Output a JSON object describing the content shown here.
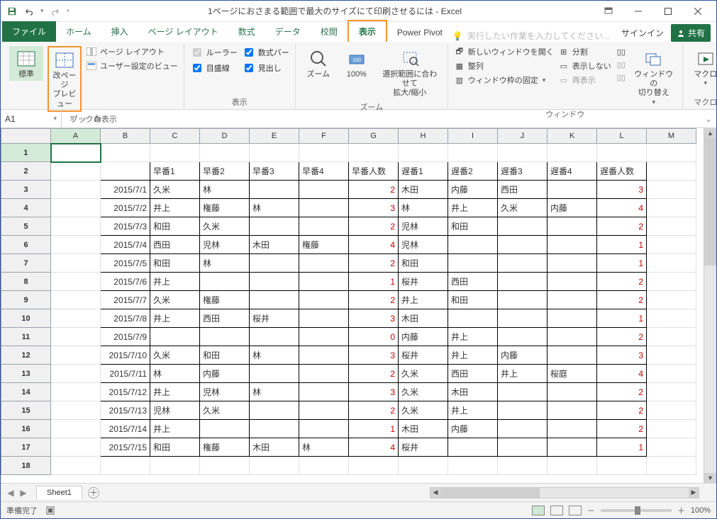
{
  "titlebar": {
    "title": "1ページにおさまる範囲で最大のサイズにて印刷させるには - Excel"
  },
  "qat": {
    "save": "save",
    "undo": "undo",
    "redo": "redo"
  },
  "tabs": {
    "file": "ファイル",
    "home": "ホーム",
    "insert": "挿入",
    "page_layout": "ページ レイアウト",
    "formulas": "数式",
    "data": "データ",
    "review": "校閲",
    "view": "表示",
    "power_pivot": "Power Pivot",
    "tell_me": "実行したい作業を入力してください...",
    "sign_in": "サインイン",
    "share": "共有"
  },
  "ribbon": {
    "g1": {
      "normal": "標準",
      "page_break": "改ページ\nプレビュー",
      "page_layout": "ページ レイアウト",
      "custom_views": "ユーザー設定のビュー",
      "title": "ブックの表示"
    },
    "g2": {
      "ruler": "ルーラー",
      "formula_bar": "数式バー",
      "gridlines": "目盛線",
      "headings": "見出し",
      "title": "表示"
    },
    "g3": {
      "zoom": "ズーム",
      "hundred": "100%",
      "fit": "選択範囲に合わせて\n拡大/縮小",
      "title": "ズーム"
    },
    "g4": {
      "new_window": "新しいウィンドウを開く",
      "arrange": "整列",
      "freeze": "ウィンドウ枠の固定",
      "split": "分割",
      "hide": "表示しない",
      "unhide": "再表示",
      "switch": "ウィンドウの\n切り替え",
      "title": "ウィンドウ"
    },
    "g5": {
      "macros": "マクロ",
      "title": "マクロ"
    }
  },
  "formula_bar": {
    "name_box": "A1",
    "fx": "fx"
  },
  "columns": [
    "A",
    "B",
    "C",
    "D",
    "E",
    "F",
    "G",
    "H",
    "I",
    "J",
    "K",
    "L",
    "M"
  ],
  "row_nums": [
    1,
    2,
    3,
    4,
    5,
    6,
    7,
    8,
    9,
    10,
    11,
    12,
    13,
    14,
    15,
    16,
    17,
    18
  ],
  "headers": [
    "",
    "早番1",
    "早番2",
    "早番3",
    "早番4",
    "早番人数",
    "遅番1",
    "遅番2",
    "遅番3",
    "遅番4",
    "遅番人数"
  ],
  "rows": [
    {
      "date": "2015/7/1",
      "c": [
        "久米",
        "林",
        "",
        "",
        2,
        "木田",
        "内藤",
        "西田",
        "",
        3
      ]
    },
    {
      "date": "2015/7/2",
      "c": [
        "井上",
        "権藤",
        "林",
        "",
        3,
        "林",
        "井上",
        "久米",
        "内藤",
        4
      ]
    },
    {
      "date": "2015/7/3",
      "c": [
        "和田",
        "久米",
        "",
        "",
        2,
        "児林",
        "和田",
        "",
        "",
        2
      ]
    },
    {
      "date": "2015/7/4",
      "c": [
        "西田",
        "児林",
        "木田",
        "権藤",
        4,
        "児林",
        "",
        "",
        "",
        1
      ]
    },
    {
      "date": "2015/7/5",
      "c": [
        "和田",
        "林",
        "",
        "",
        2,
        "和田",
        "",
        "",
        "",
        1
      ]
    },
    {
      "date": "2015/7/6",
      "c": [
        "井上",
        "",
        "",
        "",
        1,
        "桜井",
        "西田",
        "",
        "",
        2
      ]
    },
    {
      "date": "2015/7/7",
      "c": [
        "久米",
        "権藤",
        "",
        "",
        2,
        "井上",
        "和田",
        "",
        "",
        2
      ]
    },
    {
      "date": "2015/7/8",
      "c": [
        "井上",
        "西田",
        "桜井",
        "",
        3,
        "木田",
        "",
        "",
        "",
        1
      ]
    },
    {
      "date": "2015/7/9",
      "c": [
        "",
        "",
        "",
        "",
        0,
        "内藤",
        "井上",
        "",
        "",
        2
      ]
    },
    {
      "date": "2015/7/10",
      "c": [
        "久米",
        "和田",
        "林",
        "",
        3,
        "桜井",
        "井上",
        "内藤",
        "",
        3
      ]
    },
    {
      "date": "2015/7/11",
      "c": [
        "林",
        "内藤",
        "",
        "",
        2,
        "久米",
        "西田",
        "井上",
        "桜庭",
        4
      ]
    },
    {
      "date": "2015/7/12",
      "c": [
        "井上",
        "児林",
        "林",
        "",
        3,
        "久米",
        "木田",
        "",
        "",
        2
      ]
    },
    {
      "date": "2015/7/13",
      "c": [
        "児林",
        "久米",
        "",
        "",
        2,
        "久米",
        "井上",
        "",
        "",
        2
      ]
    },
    {
      "date": "2015/7/14",
      "c": [
        "井上",
        "",
        "",
        "",
        1,
        "木田",
        "内藤",
        "",
        "",
        2
      ]
    },
    {
      "date": "2015/7/15",
      "c": [
        "和田",
        "権藤",
        "木田",
        "林",
        4,
        "桜井",
        "",
        "",
        "",
        1
      ]
    }
  ],
  "sheet_tabs": {
    "sheet1": "Sheet1"
  },
  "status": {
    "ready": "準備完了",
    "zoom": "100%"
  }
}
